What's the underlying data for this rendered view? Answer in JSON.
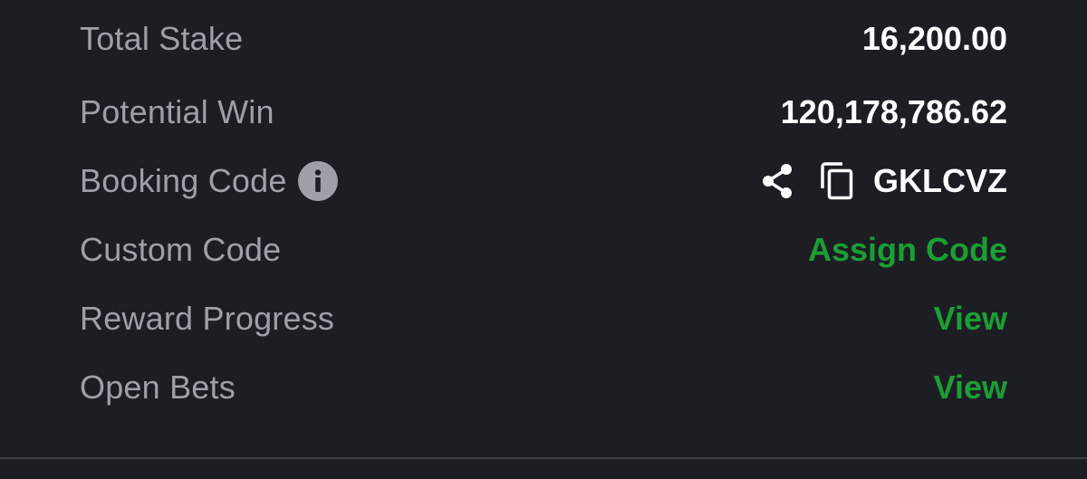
{
  "summary": {
    "total_stake": {
      "label": "Total Stake",
      "value": "16,200.00"
    },
    "potential_win": {
      "label": "Potential Win",
      "value": "120,178,786.62"
    },
    "booking_code": {
      "label": "Booking Code",
      "value": "GKLCVZ",
      "icons": [
        "info-icon",
        "share-icon",
        "copy-icon"
      ]
    },
    "custom_code": {
      "label": "Custom Code",
      "action": "Assign Code"
    },
    "reward_progress": {
      "label": "Reward Progress",
      "action": "View"
    },
    "open_bets": {
      "label": "Open Bets",
      "action": "View"
    }
  },
  "colors": {
    "background": "#1c1e24",
    "label": "#9ea0a9",
    "value": "#ffffff",
    "accent_green": "#1b9e34",
    "divider": "#3e4049"
  }
}
